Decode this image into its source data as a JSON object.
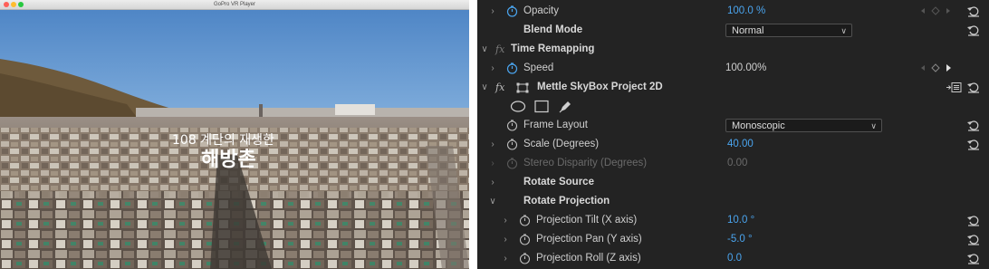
{
  "player": {
    "window_title": "GoPro VR Player",
    "overlay_line1": "108 계단의 재생한",
    "overlay_line2": "해방촌"
  },
  "colors": {
    "panel_bg": "#232323",
    "accent_blue": "#4aa4ee",
    "label_text": "#cfcfcf",
    "disabled_text": "#6a6a6a"
  },
  "effect_controls": {
    "opacity": {
      "label": "Opacity",
      "value": "100.0 %"
    },
    "blend_mode": {
      "label": "Blend Mode",
      "value": "Normal"
    },
    "time_remapping": {
      "label": "Time Remapping"
    },
    "speed": {
      "label": "Speed",
      "value": "100.00%"
    },
    "skybox": {
      "label": "Mettle SkyBox Project 2D"
    },
    "frame_layout": {
      "label": "Frame Layout",
      "value": "Monoscopic"
    },
    "scale": {
      "label": "Scale (Degrees)",
      "value": "40.00"
    },
    "stereo_disparity": {
      "label": "Stereo Disparity (Degrees)",
      "value": "0.00"
    },
    "rotate_source": {
      "label": "Rotate Source"
    },
    "rotate_projection": {
      "label": "Rotate Projection"
    },
    "projection_tilt": {
      "label": "Projection Tilt (X axis)",
      "value": "10.0 °"
    },
    "projection_pan": {
      "label": "Projection Pan (Y axis)",
      "value": "-5.0 °"
    },
    "projection_roll": {
      "label": "Projection Roll (Z axis)",
      "value": "0.0"
    }
  }
}
